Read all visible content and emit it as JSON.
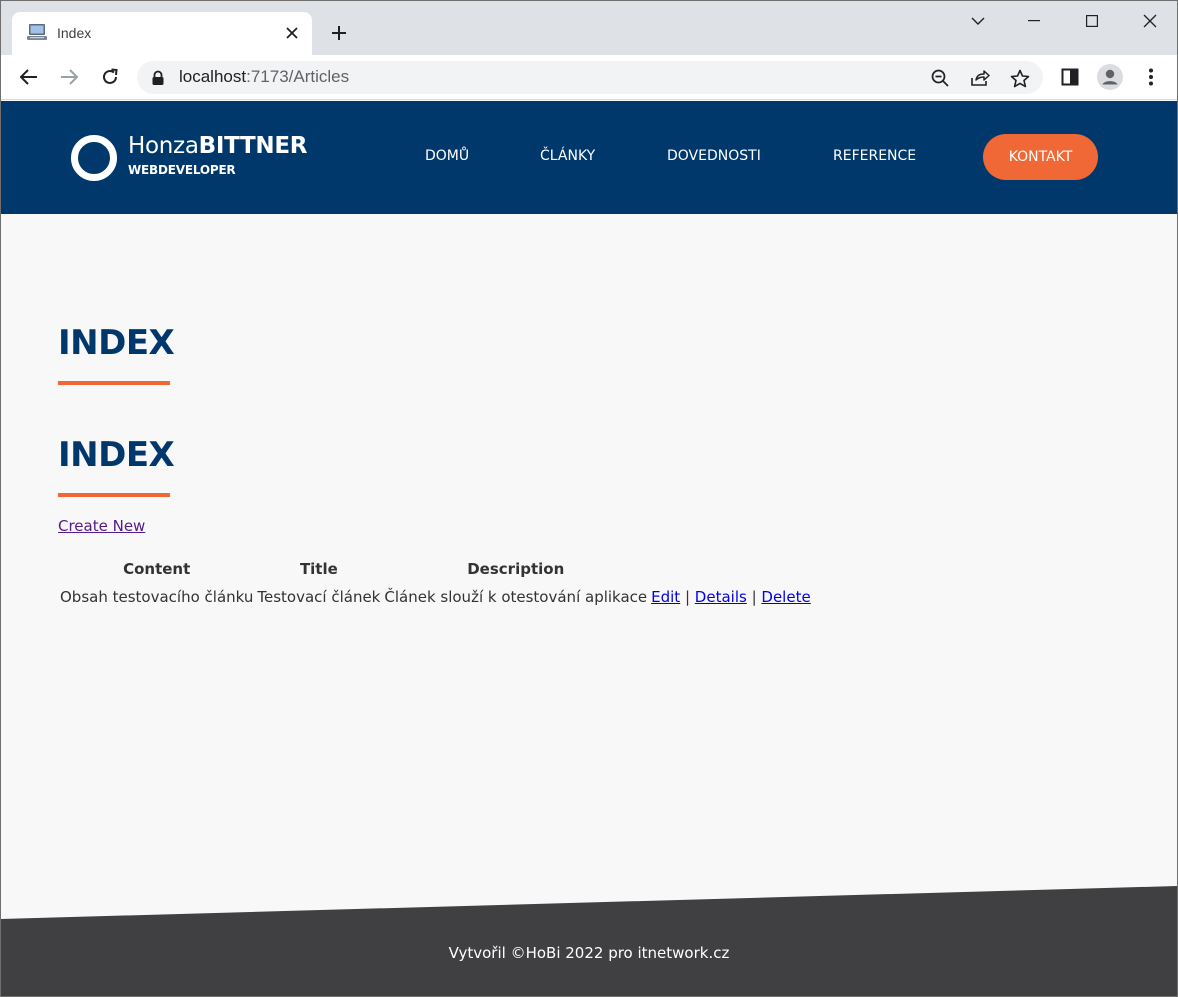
{
  "browser": {
    "tab_title": "Index",
    "url_host": "localhost",
    "url_path": ":7173/Articles"
  },
  "site": {
    "logo_first": "Honza",
    "logo_last": "BITTNER",
    "logo_sub": "WEBDEVELOPER",
    "nav": [
      "DOMŮ",
      "ČLÁNKY",
      "DOVEDNOSTI",
      "REFERENCE"
    ],
    "contact": "KONTAKT",
    "accent_color": "#f06835",
    "brand_color": "#00386c"
  },
  "page": {
    "heading_1": "INDEX",
    "heading_2": "INDEX",
    "create_new": "Create New",
    "columns": [
      "Content",
      "Title",
      "Description"
    ],
    "rows": [
      {
        "content": "Obsah testovacího článku",
        "title": "Testovací článek",
        "description": "Článek slouží k otestování aplikace",
        "actions": [
          "Edit",
          "Details",
          "Delete"
        ]
      }
    ]
  },
  "footer": {
    "text": "Vytvořil ©HoBi 2022 pro itnetwork.cz"
  }
}
